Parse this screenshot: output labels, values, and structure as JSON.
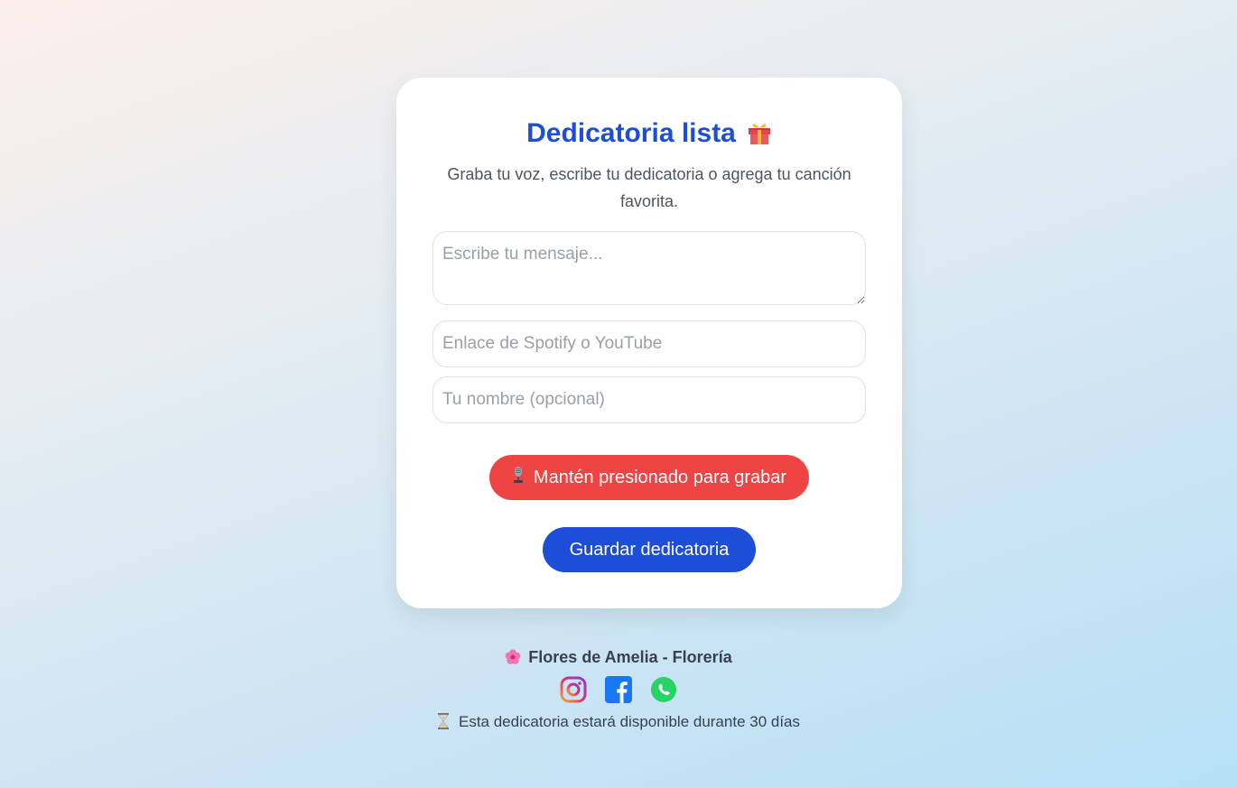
{
  "card": {
    "title": "Dedicatoria lista",
    "subtitle": "Graba tu voz, escribe tu dedicatoria o agrega tu canción favorita.",
    "message_placeholder": "Escribe tu mensaje...",
    "link_placeholder": "Enlace de Spotify o YouTube",
    "name_placeholder": "Tu nombre (opcional)",
    "record_label": "Mantén presionado para grabar",
    "save_label": "Guardar dedicatoria",
    "icons": [
      "gift-icon",
      "microphone-icon"
    ]
  },
  "footer": {
    "brand": "Flores de Amelia - Florería",
    "note": "Esta dedicatoria estará disponible durante 30 días",
    "social_icons": [
      "instagram-icon",
      "facebook-icon",
      "whatsapp-icon"
    ],
    "icons": [
      "flower-icon",
      "hourglass-icon"
    ]
  },
  "colors": {
    "title": "#1d4ed8",
    "record_button": "#ef4444",
    "save_button": "#1d4ed8"
  }
}
